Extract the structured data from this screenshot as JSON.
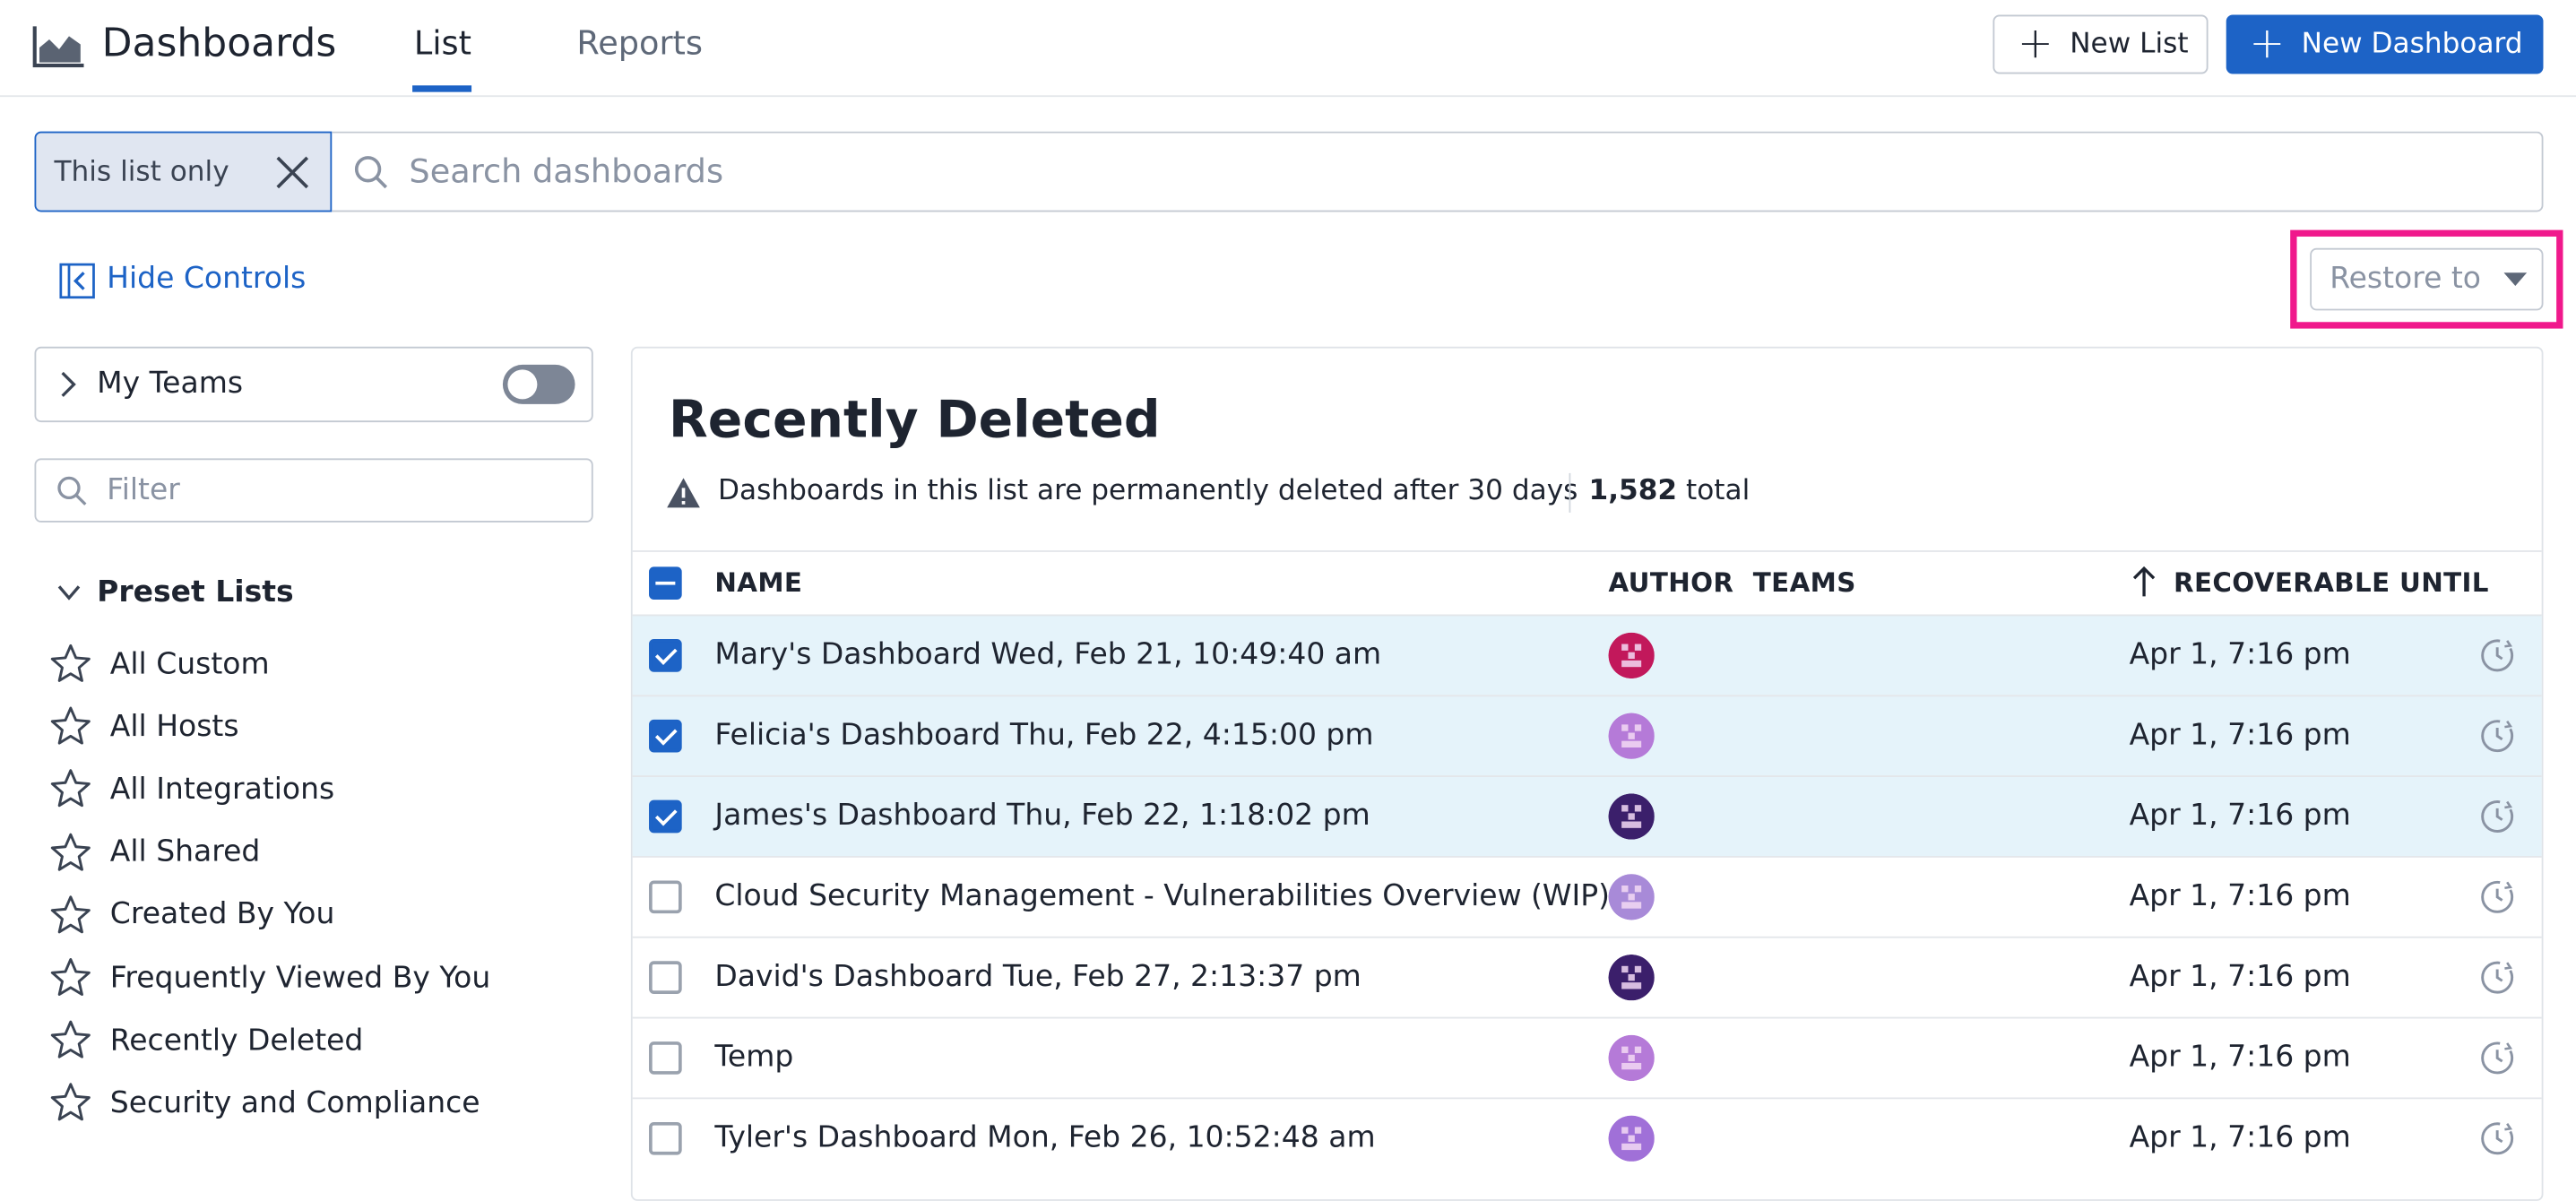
{
  "header": {
    "app_title": "Dashboards",
    "tabs": [
      {
        "label": "List",
        "active": true
      },
      {
        "label": "Reports",
        "active": false
      }
    ],
    "new_list_label": "New List",
    "new_dashboard_label": "New Dashboard"
  },
  "search": {
    "scope_chip": "This list only",
    "placeholder": "Search dashboards"
  },
  "controls": {
    "hide_controls_label": "Hide Controls",
    "restore_to_label": "Restore to"
  },
  "sidebar": {
    "my_teams_label": "My Teams",
    "my_teams_toggle_on": false,
    "filter_placeholder": "Filter",
    "preset_lists_heading": "Preset Lists",
    "preset_items": [
      "All Custom",
      "All Hosts",
      "All Integrations",
      "All Shared",
      "Created By You",
      "Frequently Viewed By You",
      "Recently Deleted",
      "Security and Compliance"
    ]
  },
  "panel": {
    "title": "Recently Deleted",
    "warning": "Dashboards in this list are permanently deleted after 30 days",
    "total_count": "1,582",
    "total_label": "total",
    "columns": {
      "name": "NAME",
      "author": "AUTHOR",
      "teams": "TEAMS",
      "recoverable": "RECOVERABLE UNTIL"
    },
    "rows": [
      {
        "name": "Mary's Dashboard Wed, Feb 21, 10:49:40 am",
        "date": "Apr 1, 7:16 pm",
        "selected": true,
        "avatar_color": "#c2185b"
      },
      {
        "name": "Felicia's Dashboard Thu, Feb 22, 4:15:00 pm",
        "date": "Apr 1, 7:16 pm",
        "selected": true,
        "avatar_color": "#b57ad8"
      },
      {
        "name": "James's Dashboard Thu, Feb 22, 1:18:02 pm",
        "date": "Apr 1, 7:16 pm",
        "selected": true,
        "avatar_color": "#3b1f6b"
      },
      {
        "name": "Cloud Security Management - Vulnerabilities Overview (WIP)",
        "date": "Apr 1, 7:16 pm",
        "selected": false,
        "avatar_color": "#a88ad8"
      },
      {
        "name": "David's Dashboard Tue, Feb 27, 2:13:37 pm",
        "date": "Apr 1, 7:16 pm",
        "selected": false,
        "avatar_color": "#3b1f6b"
      },
      {
        "name": "Temp",
        "date": "Apr 1, 7:16 pm",
        "selected": false,
        "avatar_color": "#b57ad8"
      },
      {
        "name": "Tyler's Dashboard Mon, Feb 26, 10:52:48 am",
        "date": "Apr 1, 7:16 pm",
        "selected": false,
        "avatar_color": "#a070d8"
      }
    ]
  },
  "colors": {
    "accent": "#1d63c6",
    "highlight": "#f0198c",
    "selected_row": "#e5f3fa"
  }
}
